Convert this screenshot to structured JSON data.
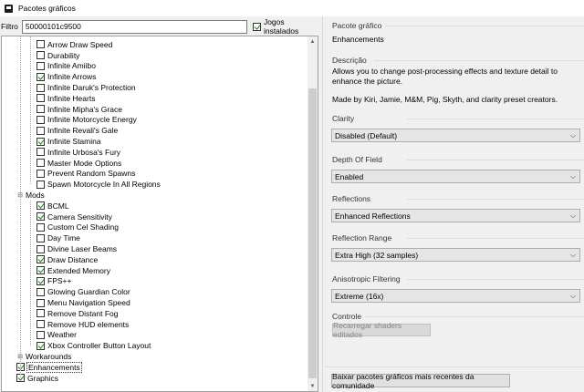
{
  "window": {
    "title": "Pacotes gráficos"
  },
  "filter": {
    "label": "Filtro",
    "value": "50000101c9500",
    "installed_label": "Jogos instalados",
    "installed_checked": true
  },
  "tree": [
    {
      "label": "Arrow Draw Speed",
      "checked": false,
      "level": 2
    },
    {
      "label": "Durability",
      "checked": false,
      "level": 2
    },
    {
      "label": "Infinite Amiibo",
      "checked": false,
      "level": 2
    },
    {
      "label": "Infinite Arrows",
      "checked": true,
      "level": 2
    },
    {
      "label": "Infinite Daruk's Protection",
      "checked": false,
      "level": 2
    },
    {
      "label": "Infinite Hearts",
      "checked": false,
      "level": 2
    },
    {
      "label": "Infinite Mipha's Grace",
      "checked": false,
      "level": 2
    },
    {
      "label": "Infinite Motorcycle Energy",
      "checked": false,
      "level": 2
    },
    {
      "label": "Infinite Revali's Gale",
      "checked": false,
      "level": 2
    },
    {
      "label": "Infinite Stamina",
      "checked": true,
      "level": 2
    },
    {
      "label": "Infinite Urbosa's Fury",
      "checked": false,
      "level": 2
    },
    {
      "label": "Master Mode Options",
      "checked": false,
      "level": 2
    },
    {
      "label": "Prevent Random Spawns",
      "checked": false,
      "level": 2
    },
    {
      "label": "Spawn Motorcycle In All Regions",
      "checked": false,
      "level": 2
    },
    {
      "label": "Mods",
      "folder": true,
      "expanded": true,
      "level": 1
    },
    {
      "label": "BCML",
      "checked": true,
      "level": 2
    },
    {
      "label": "Camera Sensitivity",
      "checked": true,
      "level": 2
    },
    {
      "label": "Custom Cel Shading",
      "checked": false,
      "level": 2
    },
    {
      "label": "Day Time",
      "checked": false,
      "level": 2
    },
    {
      "label": "Divine Laser Beams",
      "checked": false,
      "level": 2
    },
    {
      "label": "Draw Distance",
      "checked": true,
      "level": 2
    },
    {
      "label": "Extended Memory",
      "checked": true,
      "level": 2
    },
    {
      "label": "FPS++",
      "checked": true,
      "level": 2
    },
    {
      "label": "Glowing Guardian Color",
      "checked": false,
      "level": 2
    },
    {
      "label": "Menu Navigation Speed",
      "checked": false,
      "level": 2
    },
    {
      "label": "Remove Distant Fog",
      "checked": false,
      "level": 2
    },
    {
      "label": "Remove HUD elements",
      "checked": false,
      "level": 2
    },
    {
      "label": "Weather",
      "checked": false,
      "level": 2
    },
    {
      "label": "Xbox Controller Button Layout",
      "checked": true,
      "level": 2
    },
    {
      "label": "Workarounds",
      "folder": true,
      "expanded": false,
      "level": 1
    },
    {
      "label": "Enhancements",
      "checked": true,
      "level": 1,
      "selected": true
    },
    {
      "label": "Graphics",
      "checked": true,
      "level": 1
    }
  ],
  "pack": {
    "heading": "Pacote gráfico",
    "name": "Enhancements"
  },
  "description": {
    "heading": "Descrição",
    "text": "Allows you to change post-processing effects and texture detail to enhance the picture.",
    "credits": "Made by Kiri, Jamie, M&M, Pig, Skyth, and clarity preset creators."
  },
  "options": [
    {
      "heading": "Clarity",
      "value": "Disabled (Default)"
    },
    {
      "heading": "Depth Of Field",
      "value": "Enabled"
    },
    {
      "heading": "Reflections",
      "value": "Enhanced Reflections"
    },
    {
      "heading": "Reflection Range",
      "value": "Extra High (32 samples)"
    },
    {
      "heading": "Anisotropic Filtering",
      "value": "Extreme (16x)"
    }
  ],
  "control": {
    "heading": "Controle",
    "reload_label": "Recarregar shaders editados"
  },
  "download_label": "Baixar pacotes gráficos mais recentes da comunidade"
}
